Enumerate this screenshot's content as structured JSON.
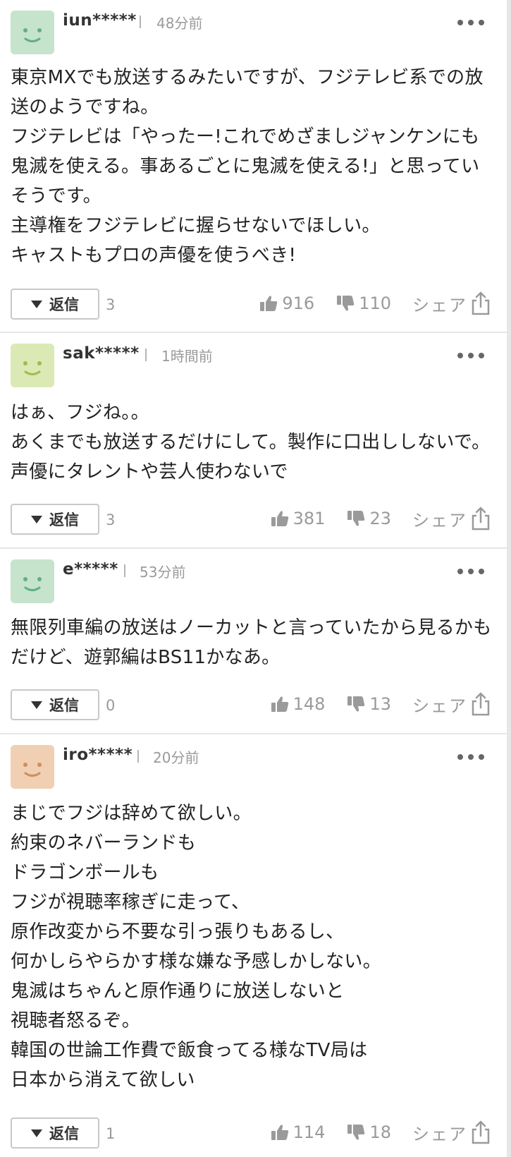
{
  "ui": {
    "reply_label": "返信",
    "share_label": "シェア",
    "icons": {
      "more": "more-horizontal-icon",
      "reply": "triangle-down-icon",
      "like": "thumbs-up-icon",
      "dislike": "thumbs-down-icon",
      "share": "share-upload-icon"
    }
  },
  "comments": [
    {
      "username": "iun*****",
      "time": "48分前",
      "avatar_color": "#c6e3cb",
      "face_color": "#5fae8a",
      "text": "東京MXでも放送するみたいですが、フジテレビ系での放送のようですね。\nフジテレビは「やったー!これでめざましジャンケンにも鬼滅を使える。事あるごとに鬼滅を使える!」と思っていそうです。\n主導権をフジテレビに握らせないでほしい。\nキャストもプロの声優を使うべき!",
      "reply_count": "3",
      "likes": "916",
      "dislikes": "110"
    },
    {
      "username": "sak*****",
      "time": "1時間前",
      "avatar_color": "#dbe9b4",
      "face_color": "#9ebc4f",
      "text": "はぁ、フジね。。\nあくまでも放送するだけにして。製作に口出ししないで。声優にタレントや芸人使わないで",
      "reply_count": "3",
      "likes": "381",
      "dislikes": "23"
    },
    {
      "username": "e*****",
      "time": "53分前",
      "avatar_color": "#c6e3cb",
      "face_color": "#5fae8a",
      "text": "無限列車編の放送はノーカットと言っていたから見るかもだけど、遊郭編はBS11かなあ。",
      "reply_count": "0",
      "likes": "148",
      "dislikes": "13"
    },
    {
      "username": "iro*****",
      "time": "20分前",
      "avatar_color": "#f0cfb2",
      "face_color": "#cf8f5c",
      "text": "まじでフジは辞めて欲しい。\n約束のネバーランドも\nドラゴンボールも\nフジが視聴率稼ぎに走って、\n原作改変から不要な引っ張りもあるし、\n何かしらやらかす様な嫌な予感しかしない。\n鬼滅はちゃんと原作通りに放送しないと\n視聴者怒るぞ。\n韓国の世論工作費で飯食ってる様なTV局は\n日本から消えて欲しい",
      "reply_count": "1",
      "likes": "114",
      "dislikes": "18"
    }
  ]
}
